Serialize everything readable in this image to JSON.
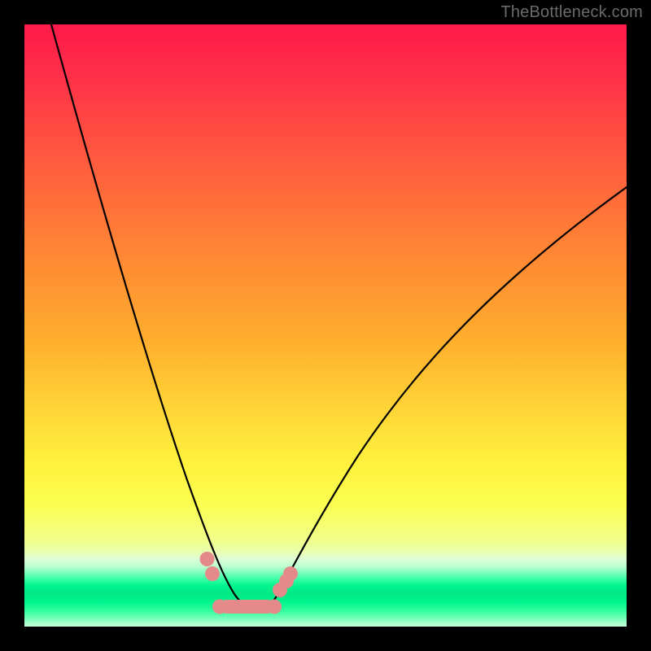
{
  "watermark": "TheBottleneck.com",
  "chart_data": {
    "type": "line",
    "title": "",
    "xlabel": "",
    "ylabel": "",
    "x": [
      0.0,
      0.05,
      0.1,
      0.15,
      0.2,
      0.25,
      0.3,
      0.33,
      0.36,
      0.4,
      0.45,
      0.5,
      0.55,
      0.6,
      0.65,
      0.7,
      0.75,
      0.8,
      0.85,
      0.9,
      0.95,
      1.0
    ],
    "y": [
      1.0,
      0.83,
      0.66,
      0.5,
      0.35,
      0.22,
      0.12,
      0.06,
      0.03,
      0.03,
      0.05,
      0.1,
      0.17,
      0.25,
      0.33,
      0.41,
      0.49,
      0.56,
      0.62,
      0.67,
      0.71,
      0.73
    ],
    "xlim": [
      0,
      1
    ],
    "ylim": [
      0,
      1
    ],
    "markers": {
      "left_vertical": [
        {
          "x": 0.303,
          "y": 0.112
        },
        {
          "x": 0.312,
          "y": 0.088
        }
      ],
      "right_vertical": [
        {
          "x": 0.424,
          "y": 0.06
        },
        {
          "x": 0.435,
          "y": 0.075
        },
        {
          "x": 0.442,
          "y": 0.087
        }
      ],
      "bottom_bar": {
        "x0": 0.325,
        "x1": 0.415,
        "y": 0.033
      }
    },
    "background_gradient": {
      "top": "#ff1a4a",
      "mid": "#fff23d",
      "green_band": "#00e885",
      "bottom": "#c8ffda"
    }
  }
}
